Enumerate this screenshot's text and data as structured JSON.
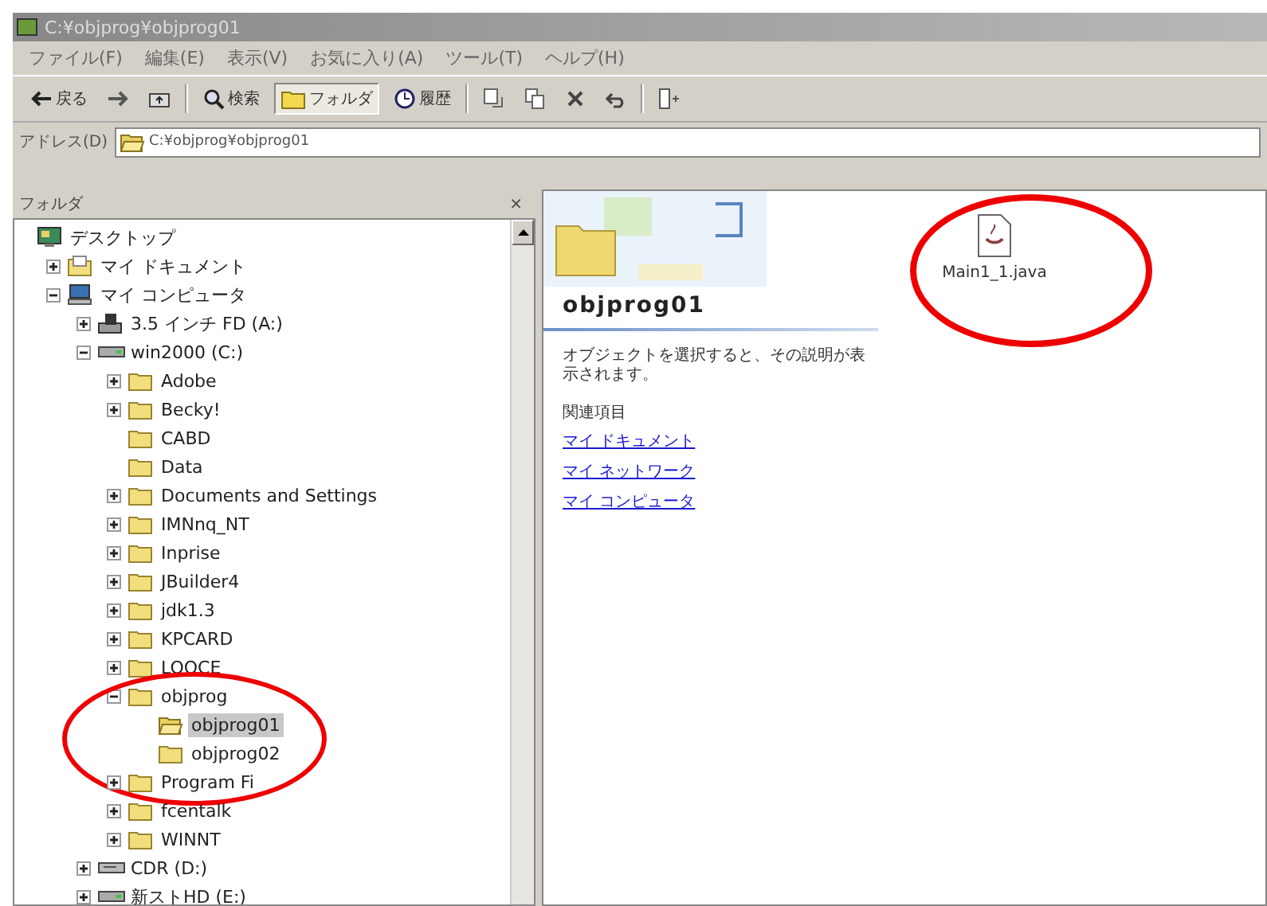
{
  "window": {
    "title": "C:¥objprog¥objprog01"
  },
  "menu": [
    "ファイル(F)",
    "編集(E)",
    "表示(V)",
    "お気に入り(A)",
    "ツール(T)",
    "ヘルプ(H)"
  ],
  "toolbar": [
    {
      "kind": "back",
      "label": "戻る",
      "pressed": false
    },
    {
      "kind": "forward",
      "pressed": false
    },
    {
      "kind": "up",
      "pressed": false
    },
    {
      "kind": "search",
      "label": "検索",
      "pressed": false
    },
    {
      "kind": "folders",
      "label": "フォルダ",
      "pressed": true
    },
    {
      "kind": "history",
      "label": "履歴",
      "pressed": false
    },
    {
      "kind": "move",
      "pressed": false
    },
    {
      "kind": "copy",
      "pressed": false
    },
    {
      "kind": "delete",
      "pressed": false
    },
    {
      "kind": "undo",
      "pressed": false
    },
    {
      "kind": "views",
      "pressed": false
    }
  ],
  "address": {
    "label": "アドレス(D)",
    "value": "C:¥objprog¥objprog01"
  },
  "folder_pane": {
    "title": "フォルダ",
    "close": "×",
    "tree": [
      {
        "label": "デスクトップ",
        "kind": "desktop",
        "selected": false,
        "circled": false,
        "children": [
          {
            "label": "マイ ドキュメント",
            "kind": "documents",
            "expanded": false,
            "selected": false,
            "circled": false
          },
          {
            "label": "マイ コンピュータ",
            "kind": "computer",
            "expanded": true,
            "selected": false,
            "circled": false,
            "children": [
              {
                "label": "3.5 インチ FD (A:)",
                "kind": "floppy",
                "expanded": false,
                "selected": false,
                "circled": false
              },
              {
                "label": "win2000 (C:)",
                "kind": "drive",
                "expanded": true,
                "selected": false,
                "circled": false,
                "children": [
                  {
                    "label": "Adobe",
                    "kind": "folder",
                    "expanded": false,
                    "selected": false,
                    "circled": false
                  },
                  {
                    "label": "Becky!",
                    "kind": "folder",
                    "expanded": false,
                    "selected": false,
                    "circled": false
                  },
                  {
                    "label": "CABD",
                    "kind": "leaf",
                    "selected": false,
                    "circled": false
                  },
                  {
                    "label": "Data",
                    "kind": "leaf",
                    "selected": false,
                    "circled": false
                  },
                  {
                    "label": "Documents and Settings",
                    "kind": "folder",
                    "expanded": false,
                    "selected": false,
                    "circled": false
                  },
                  {
                    "label": "IMNnq_NT",
                    "kind": "folder",
                    "expanded": false,
                    "selected": false,
                    "circled": false
                  },
                  {
                    "label": "Inprise",
                    "kind": "folder",
                    "expanded": false,
                    "selected": false,
                    "circled": false
                  },
                  {
                    "label": "JBuilder4",
                    "kind": "folder",
                    "expanded": false,
                    "selected": false,
                    "circled": false
                  },
                  {
                    "label": "jdk1.3",
                    "kind": "folder",
                    "expanded": false,
                    "selected": false,
                    "circled": false
                  },
                  {
                    "label": "KPCARD",
                    "kind": "folder",
                    "expanded": false,
                    "selected": false,
                    "circled": false
                  },
                  {
                    "label": "LOOCE",
                    "kind": "folder",
                    "expanded": false,
                    "selected": false,
                    "circled": false
                  },
                  {
                    "label": "objprog",
                    "kind": "folder",
                    "expanded": true,
                    "selected": false,
                    "circled": true,
                    "children": [
                      {
                        "label": "objprog01",
                        "kind": "leaf",
                        "selected": true,
                        "circled": false
                      },
                      {
                        "label": "objprog02",
                        "kind": "leaf",
                        "selected": false,
                        "circled": false
                      }
                    ]
                  },
                  {
                    "label": "Program Fi",
                    "kind": "folder",
                    "expanded": false,
                    "selected": false,
                    "circled": false
                  },
                  {
                    "label": "fcentalk",
                    "kind": "folder",
                    "expanded": false,
                    "selected": false,
                    "circled": false
                  },
                  {
                    "label": "WINNT",
                    "kind": "folder",
                    "expanded": false,
                    "selected": false,
                    "circled": false
                  }
                ]
              },
              {
                "label": "CDR (D:)",
                "kind": "cdrom",
                "expanded": false,
                "selected": false,
                "circled": false
              },
              {
                "label": "新ストHD (E:)",
                "kind": "drive",
                "expanded": false,
                "selected": false,
                "circled": false
              }
            ]
          }
        ]
      }
    ]
  },
  "task_pane": {
    "title": "objprog01",
    "description": "オブジェクトを選択すると、その説明が表示されます。",
    "related_title": "関連項目",
    "links": [
      "マイ ドキュメント",
      "マイ ネットワーク",
      "マイ コンピュータ"
    ]
  },
  "files": [
    {
      "name": "Main1_1.java",
      "circled": true
    }
  ]
}
